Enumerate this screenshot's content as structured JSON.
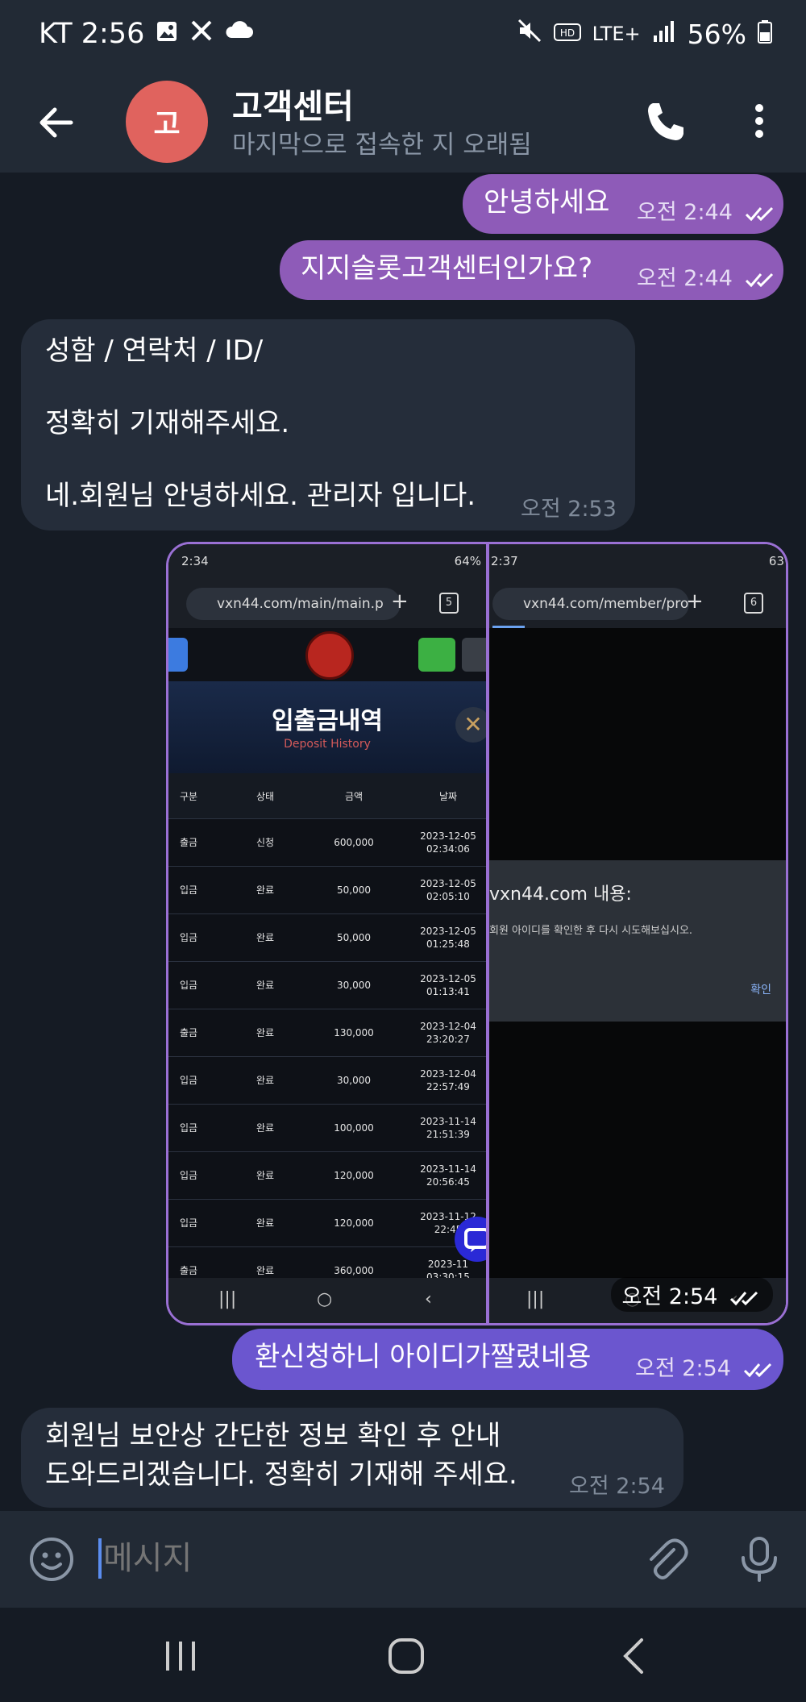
{
  "status_bar": {
    "carrier_time": "KT 2:56",
    "battery": "56%",
    "network": "LTE+"
  },
  "header": {
    "avatar_letter": "고",
    "title": "고객센터",
    "subtitle": "마지막으로 접속한 지 오래됨"
  },
  "messages": [
    {
      "text": "안녕하세요",
      "time": "오전 2:44"
    },
    {
      "text": "지지슬롯고객센터인가요?",
      "time": "오전 2:44"
    },
    {
      "lines": [
        "성함 / 연락처 / ID/",
        "정확히 기재해주세요.",
        "네.회원님 안녕하세요. 관리자 입니다."
      ],
      "time": "오전 2:53"
    },
    {
      "time": "오전 2:54"
    },
    {
      "text": "환신청하니 아이디가짤렸네용",
      "time": "오전 2:54"
    },
    {
      "lines": [
        "회원님 보안상 간단한 정보 확인 후 안내",
        "도와드리겠습니다. 정확히 기재해 주세요."
      ],
      "time": "오전 2:54"
    }
  ],
  "screenshot_left": {
    "status_time": "2:34",
    "battery": "64%",
    "url": "vxn44.com/main/main.p",
    "tab_count": "5",
    "title": "입출금내역",
    "subtitle": "Deposit History",
    "columns": [
      "구분",
      "상태",
      "금액",
      "날짜"
    ],
    "rows": [
      [
        "출금",
        "신청",
        "600,000",
        "2023-12-05",
        "02:34:06"
      ],
      [
        "입금",
        "완료",
        "50,000",
        "2023-12-05",
        "02:05:10"
      ],
      [
        "입금",
        "완료",
        "50,000",
        "2023-12-05",
        "01:25:48"
      ],
      [
        "입금",
        "완료",
        "30,000",
        "2023-12-05",
        "01:13:41"
      ],
      [
        "출금",
        "완료",
        "130,000",
        "2023-12-04",
        "23:20:27"
      ],
      [
        "입금",
        "완료",
        "30,000",
        "2023-12-04",
        "22:57:49"
      ],
      [
        "입금",
        "완료",
        "100,000",
        "2023-11-14",
        "21:51:39"
      ],
      [
        "입금",
        "완료",
        "120,000",
        "2023-11-14",
        "20:56:45"
      ],
      [
        "입금",
        "완료",
        "120,000",
        "2023-11-12",
        "22:45"
      ],
      [
        "출금",
        "완료",
        "360,000",
        "2023-11",
        "03:30:15"
      ]
    ]
  },
  "screenshot_right": {
    "status_time": "2:37",
    "battery": "63",
    "url": "vxn44.com/member/pro",
    "tab_count": "6",
    "dialog_title": "vxn44.com 내용:",
    "dialog_message": "회원 아이디를 확인한 후 다시 시도해보십시오.",
    "dialog_ok": "확인"
  },
  "input": {
    "placeholder": "메시지"
  },
  "colors": {
    "outgoing": "#8e5bb8",
    "outgoing_recent": "#6b56cf",
    "incoming": "#252d3a",
    "avatar": "#e0635e",
    "background": "#151b24"
  }
}
